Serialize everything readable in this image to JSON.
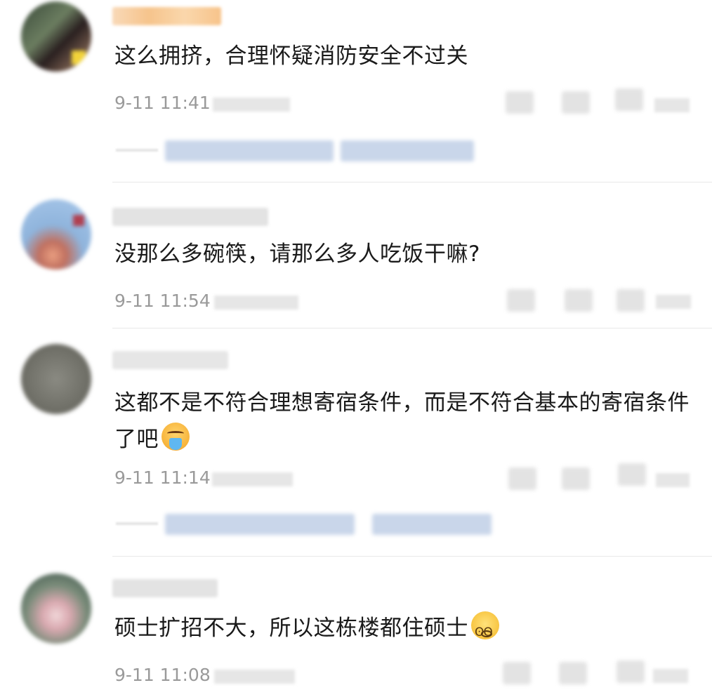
{
  "comments": [
    {
      "text": "这么拥挤，合理怀疑消防安全不过关",
      "time": "9-11 11:41",
      "emoji": ""
    },
    {
      "text": "没那么多碗筷，请那么多人吃饭干嘛?",
      "time": "9-11 11:54",
      "emoji": ""
    },
    {
      "text": "这都不是不符合理想寄宿条件，而是不符合基本的寄宿条件了吧",
      "time": "9-11 11:14",
      "emoji": "vomit-emoji"
    },
    {
      "text": "硕士扩招不大，所以这栋楼都住硕士",
      "time": "9-11 11:08",
      "emoji": "dizzy-emoji"
    }
  ],
  "colors": {
    "text": "#1a1a1a",
    "meta": "#9a9a9a",
    "reply_link": "#c9d6ea",
    "divider": "#e8e8e8"
  }
}
